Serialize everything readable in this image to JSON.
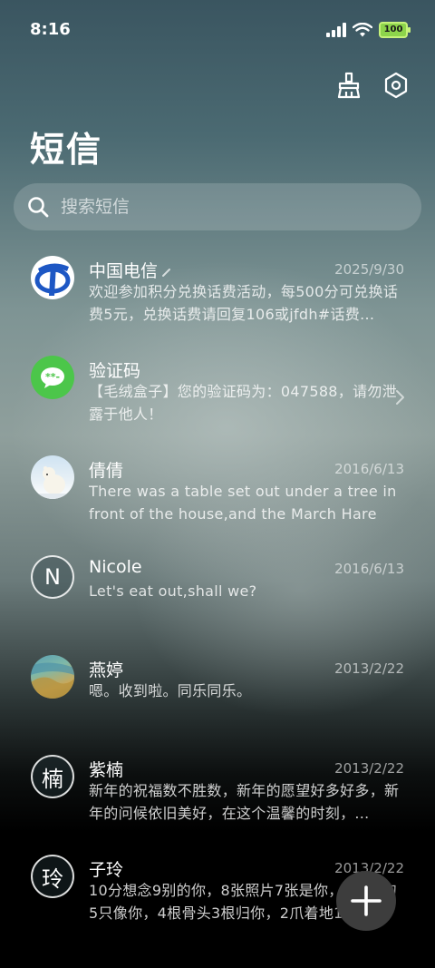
{
  "status_bar": {
    "time": "8:16",
    "battery": "100"
  },
  "header": {
    "title": "短信"
  },
  "search": {
    "placeholder": "搜索短信"
  },
  "conversations": [
    {
      "name": "中国电信",
      "date": "2025/9/30",
      "preview": "欢迎参加积分兑换话费活动，每500分可兑换话费5元，兑换话费请回复106或jfdh#话费..."
    },
    {
      "name": "验证码",
      "date": "",
      "preview": "【毛绒盒子】您的验证码为：047588，请勿泄露于他人！"
    },
    {
      "name": "倩倩",
      "date": "2016/6/13",
      "preview": "There was a table set out under a tree in front of the house,and the March Hare an..."
    },
    {
      "name": "Nicole",
      "date": "2016/6/13",
      "preview": "Let's eat out,shall we?",
      "avatar_letter": "N"
    },
    {
      "name": "燕婷",
      "date": "2013/2/22",
      "preview": "嗯。收到啦。同乐同乐。"
    },
    {
      "name": "紫楠",
      "date": "2013/2/22",
      "preview": "新年的祝福数不胜数，新年的愿望好多好多，新年的问候依旧美好，在这个温馨的时刻，...",
      "avatar_letter": "楠"
    },
    {
      "name": "子玲",
      "date": "2013/2/22",
      "preview": "10分想念9别的你，8张照片7张是你，6只小狗5只像你，4根骨头3根归你，2爪着地1定...",
      "avatar_letter": "玲"
    }
  ],
  "colors": {
    "fab": "#3d3d3d",
    "telecom_blue": "#1d57c4",
    "verify_green": "#4cc64a",
    "battery_green": "#8dd44b"
  }
}
